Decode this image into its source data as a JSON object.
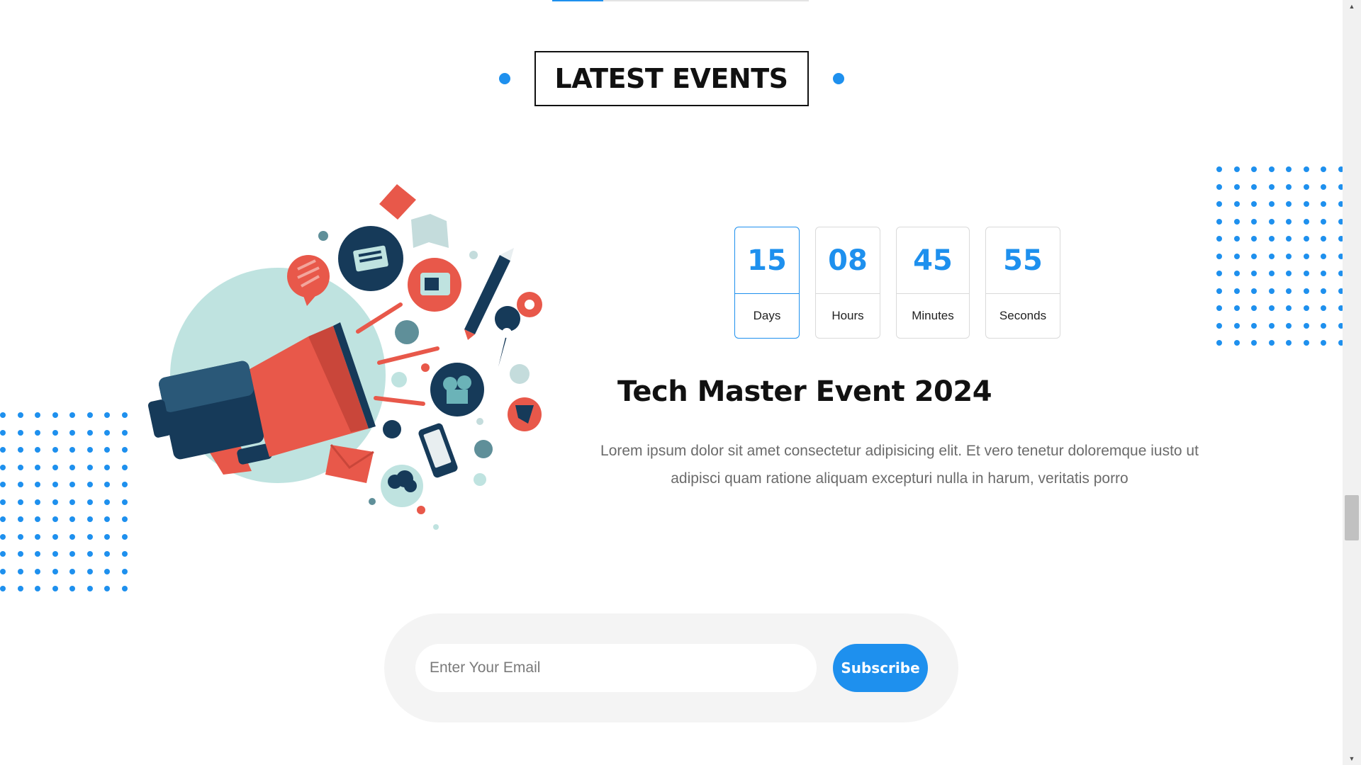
{
  "section": {
    "title": "LATEST EVENTS"
  },
  "countdown": [
    {
      "value": "15",
      "label": "Days"
    },
    {
      "value": "08",
      "label": "Hours"
    },
    {
      "value": "45",
      "label": "Minutes"
    },
    {
      "value": "55",
      "label": "Seconds"
    }
  ],
  "event": {
    "title": "Tech Master Event 2024",
    "description": "Lorem ipsum dolor sit amet consectetur adipisicing elit. Et vero tenetur doloremque iusto ut adipisci quam ratione aliquam excepturi nulla in harum, veritatis porro"
  },
  "subscribe": {
    "email_placeholder": "Enter Your Email",
    "button_label": "Subscribe"
  },
  "illustration": {
    "icon": "megaphone-marketing-illustration"
  },
  "colors": {
    "accent": "#1e90ee",
    "megaphone_red": "#e8584a",
    "navy": "#163a59",
    "mint": "#bfe3e0"
  }
}
